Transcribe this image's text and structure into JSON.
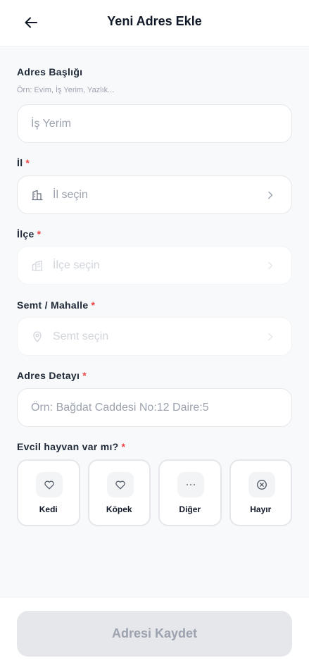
{
  "header": {
    "title": "Yeni Adres Ekle"
  },
  "form": {
    "address_title": {
      "label": "Adres Başlığı",
      "hint": "Örn: Evim, İş Yerim, Yazlık...",
      "placeholder": "İş Yerim"
    },
    "city": {
      "label": "İl",
      "required": "*",
      "placeholder": "İl seçin"
    },
    "district": {
      "label": "İlçe",
      "required": "*",
      "placeholder": "İlçe seçin"
    },
    "neighborhood": {
      "label": "Semt / Mahalle",
      "required": "*",
      "placeholder": "Semt seçin"
    },
    "address_detail": {
      "label": "Adres Detayı",
      "required": "*",
      "placeholder": "Örn: Bağdat Caddesi No:12 Daire:5"
    },
    "pet": {
      "label": "Evcil hayvan var mı?",
      "required": "*",
      "options": [
        {
          "label": "Kedi",
          "icon": "heart-icon"
        },
        {
          "label": "Köpek",
          "icon": "heart-icon"
        },
        {
          "label": "Diğer",
          "icon": "more-icon"
        },
        {
          "label": "Hayır",
          "icon": "x-circle-icon"
        }
      ]
    }
  },
  "footer": {
    "save_label": "Adresi Kaydet"
  },
  "colors": {
    "accent_required": "#ef4444",
    "text": "#111827",
    "muted": "#9ca3af",
    "disabled_button": "#e5e7eb"
  }
}
